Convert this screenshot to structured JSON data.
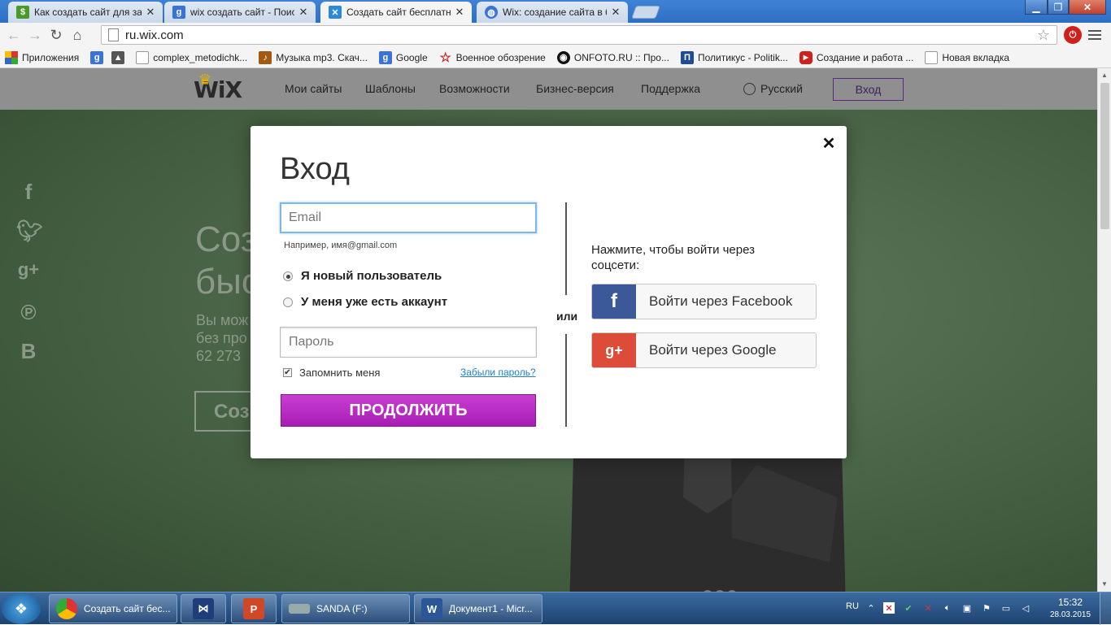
{
  "browser": {
    "tabs": [
      {
        "label": "Как создать сайт для зара",
        "favicon": "dollar-icon",
        "color": "#4a9a2a"
      },
      {
        "label": "wix создать сайт - Поиск",
        "favicon": "google-icon",
        "color": "#3a73d8"
      },
      {
        "label": "Создать сайт бесплатно |",
        "favicon": "wix-icon",
        "color": "#2a8ad8",
        "active": true
      },
      {
        "label": "Wix: создание сайта в бес",
        "favicon": "globe-icon",
        "color": "#3a73d8"
      }
    ],
    "url": "ru.wix.com",
    "bookmarks": [
      {
        "label": "Приложения",
        "icon": "apps-icon"
      },
      {
        "label": "",
        "icon": "google-icon"
      },
      {
        "label": "",
        "icon": "graduation-cap-icon"
      },
      {
        "label": "complex_metodichk...",
        "icon": "page-icon"
      },
      {
        "label": "Музыка mp3. Скач...",
        "icon": "music-icon"
      },
      {
        "label": "Google",
        "icon": "google-icon"
      },
      {
        "label": "Военное обозрение",
        "icon": "star-icon"
      },
      {
        "label": "ONFOTO.RU :: Про...",
        "icon": "camera-icon"
      },
      {
        "label": "Политикус - Politik...",
        "icon": "politikus-icon"
      },
      {
        "label": "Создание и работа ...",
        "icon": "youtube-icon"
      },
      {
        "label": "Новая вкладка",
        "icon": "page-icon"
      }
    ]
  },
  "site": {
    "logo": "WiX",
    "nav": [
      "Мои сайты",
      "Шаблоны",
      "Возможности",
      "Бизнес-версия",
      "Поддержка"
    ],
    "language": "Русский",
    "login": "Вход",
    "hero": {
      "title_line1": "Соз",
      "title_line2": "быс",
      "text_line1": "Вы мож",
      "text_line2": "без про",
      "text_line3": "62 273",
      "button": "Соз"
    }
  },
  "modal": {
    "title": "Вход",
    "email_placeholder": "Email",
    "email_hint": "Например, имя@gmail.com",
    "radio_new": "Я новый пользователь",
    "radio_existing": "У меня уже есть аккаунт",
    "password_placeholder": "Пароль",
    "remember": "Запомнить меня",
    "forgot": "Забыли пароль?",
    "continue": "ПРОДОЛЖИТЬ",
    "or": "или",
    "social_hint": "Нажмите, чтобы войти через соцсети:",
    "facebook": "Войти через Facebook",
    "google": "Войти через Google",
    "colors": {
      "facebook": "#3b5998",
      "google": "#dd4b39",
      "continue": "#b52bc0"
    }
  },
  "taskbar": {
    "items": [
      {
        "label": "Создать сайт бес...",
        "icon": "chrome-icon"
      },
      {
        "label": "",
        "icon": "visual-studio-icon"
      },
      {
        "label": "",
        "icon": "powerpoint-icon"
      },
      {
        "label": "SANDA (F:)",
        "icon": "drive-icon"
      },
      {
        "label": "Документ1 - Micr...",
        "icon": "word-icon"
      }
    ],
    "language": "RU",
    "time": "15:32",
    "date": "28.03.2015"
  }
}
